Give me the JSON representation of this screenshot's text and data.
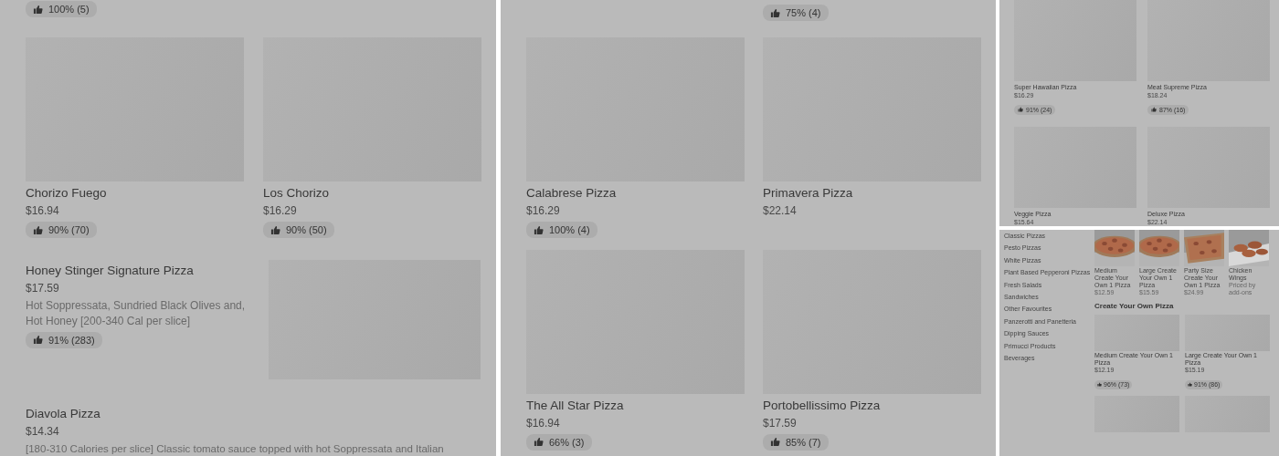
{
  "panel_1": {
    "top_rating": "100% (5)",
    "cards": [
      {
        "title": "Chorizo Fuego",
        "price": "$16.94",
        "rating": "90% (70)"
      },
      {
        "title": "Los Chorizo",
        "price": "$16.29",
        "rating": "90% (50)"
      }
    ],
    "rows": [
      {
        "title": "Honey Stinger Signature Pizza",
        "price": "$17.59",
        "description": "Hot Soppressata, Sundried Black Olives and, Hot Honey [200-340 Cal per slice]",
        "rating": "91% (283)",
        "has_image": true
      },
      {
        "title": "Diavola Pizza",
        "price": "$14.34",
        "description": "[180-310 Calories per slice] Classic tomato sauce topped with hot Soppressata and Italian",
        "has_image": false
      }
    ]
  },
  "panel_2": {
    "top_rating": "75% (4)",
    "cards": [
      {
        "title": "Calabrese Pizza",
        "price": "$16.29",
        "rating": "100% (4)"
      },
      {
        "title": "Primavera Pizza",
        "price": "$22.14"
      },
      {
        "title": "The All Star Pizza",
        "price": "$16.94",
        "rating": "66% (3)"
      },
      {
        "title": "Portobellissimo Pizza",
        "price": "$17.59",
        "rating": "85% (7)"
      }
    ]
  },
  "panel_3": {
    "cards": [
      {
        "title": "Super Hawaiian Pizza",
        "price": "$16.29",
        "rating": "91% (24)"
      },
      {
        "title": "Meat Supreme Pizza",
        "price": "$18.24",
        "rating": "87% (16)"
      },
      {
        "title": "Veggie Pizza",
        "price": "$15.64"
      },
      {
        "title": "Deluxe Pizza",
        "price": "$22.14"
      }
    ]
  },
  "panel_4": {
    "categories": [
      "Classic Pizzas",
      "Pesto Pizzas",
      "White Pizzas",
      "Plant Based Pepperoni Pizzas",
      "Fresh Salads",
      "Sandwiches",
      "Other Favourites",
      "Panzerotti and Panetteria",
      "Dipping Sauces",
      "Primucci Products",
      "Beverages"
    ],
    "featured": [
      {
        "title": "Medium Create Your Own 1 Pizza",
        "price": "$12.59",
        "kind": "picture"
      },
      {
        "title": "Large Create Your Own 1 Pizza",
        "price": "$15.59",
        "kind": "picture"
      },
      {
        "title": "Party Size Create Your Own 1 Pizza",
        "price": "$24.99",
        "kind": "picture"
      },
      {
        "title": "Chicken Wings",
        "price": "Priced by add-ons",
        "kind": "picture"
      }
    ],
    "section_title": "Create Your Own Pizza",
    "cards": [
      {
        "kind": "item",
        "title": "Medium Create Your Own 1 Pizza",
        "price": "$12.19",
        "rating": "96% (73)"
      },
      {
        "kind": "item",
        "title": "Large Create Your Own 1 Pizza",
        "price": "$15.19",
        "rating": "91% (86)"
      },
      {
        "kind": "loading"
      },
      {
        "kind": "loading"
      }
    ]
  }
}
